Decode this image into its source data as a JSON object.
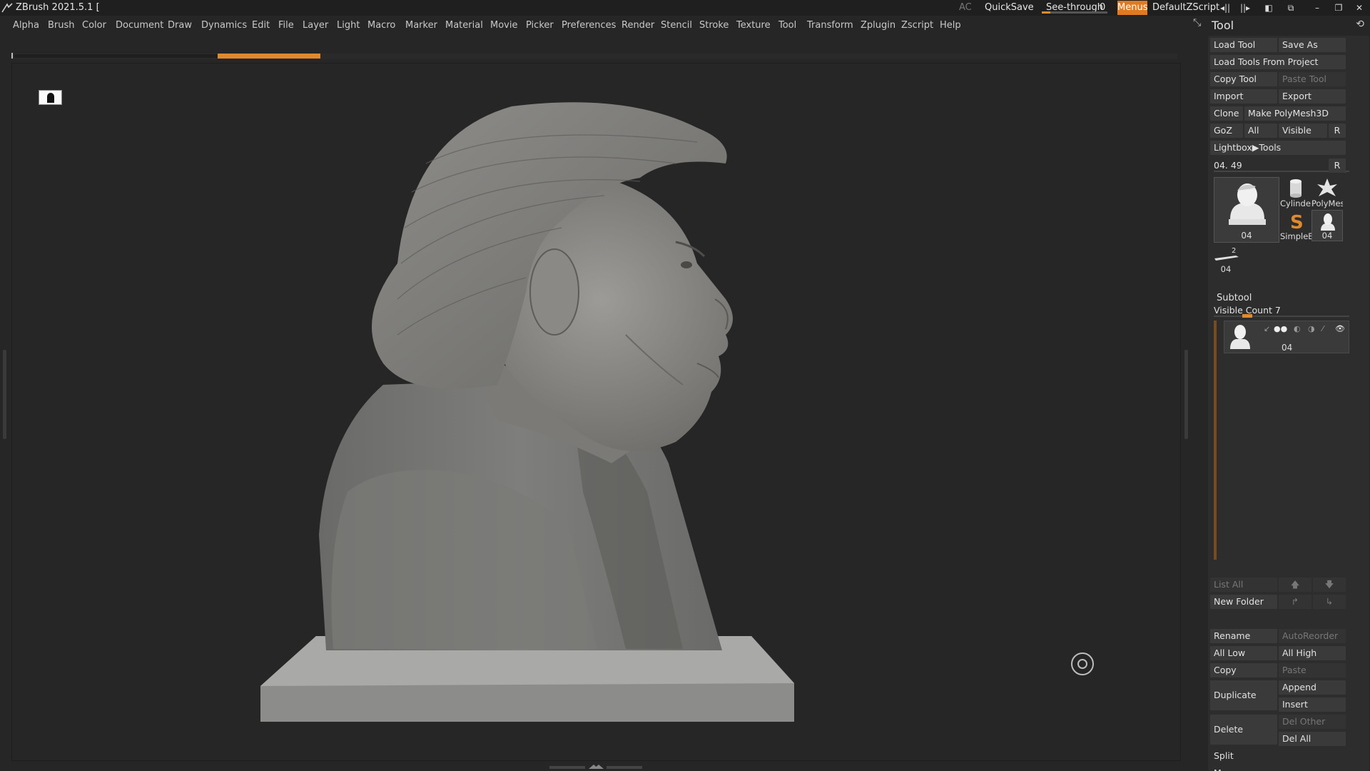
{
  "titlebar": {
    "app_title": "ZBrush 2021.5.1 [",
    "ac": "AC",
    "quicksave": "QuickSave",
    "seethrough_label": "See-through",
    "seethrough_value": "0",
    "menus": "Menus",
    "default_zscript": "DefaultZScript"
  },
  "menubar": {
    "items": [
      "Alpha",
      "Brush",
      "Color",
      "Document",
      "Draw",
      "Dynamics",
      "Edit",
      "File",
      "Layer",
      "Light",
      "Macro",
      "Marker",
      "Material",
      "Movie",
      "Picker",
      "Preferences",
      "Render",
      "Stencil",
      "Stroke",
      "Texture",
      "Tool",
      "Transform",
      "Zplugin",
      "Zscript",
      "Help"
    ]
  },
  "tool_panel": {
    "title": "Tool",
    "load_tool": "Load Tool",
    "save_as": "Save As",
    "load_tools_from_project": "Load Tools From Project",
    "copy_tool": "Copy Tool",
    "paste_tool": "Paste Tool",
    "import": "Import",
    "export": "Export",
    "clone": "Clone",
    "make_polymesh": "Make PolyMesh3D",
    "goz": "GoZ",
    "all": "All",
    "visible": "Visible",
    "r": "R",
    "lightbox_tools": "Lightbox▶Tools",
    "current_tool_slider": "04. 49",
    "thumbnails": {
      "main": "04",
      "cylinder": "Cylinder",
      "polymesh": "PolyMes",
      "simpleb": "SimpleB",
      "small_04": "04",
      "bottom_04": "04",
      "bottom_count": "2"
    }
  },
  "subtool": {
    "title": "Subtool",
    "visible_count": "Visible Count 7",
    "item_caption": "04",
    "list_all": "List All",
    "new_folder": "New Folder",
    "rename": "Rename",
    "autoreorder": "AutoReorder",
    "all_low": "All Low",
    "all_high": "All High",
    "copy": "Copy",
    "paste": "Paste",
    "duplicate": "Duplicate",
    "append": "Append",
    "insert": "Insert",
    "delete": "Delete",
    "del_other": "Del Other",
    "del_all": "Del All",
    "split": "Split",
    "merge": "Merge"
  },
  "colors": {
    "accent_orange": "#e07a20",
    "background": "#262626",
    "panel": "#2d2d2d",
    "button": "#3a3a3a"
  }
}
